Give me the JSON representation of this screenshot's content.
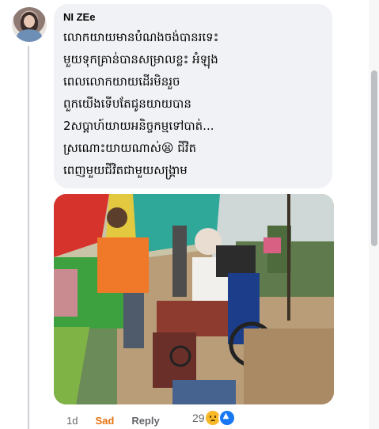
{
  "comment": {
    "author": "NI ZEe",
    "text": "លោកយាយមានបំណងចង់បានរទេះ\nមួយទុកគ្រាន់បានសម្រាលខ្លះ អំឡុង\nពេលលោកយាយដើរមិនរួច\nពួកយើងទើបតែជូនយាយបាន\n2សប្តាហ៍យាយអនិច្ចកម្មទៅបាត់...\nស្រណោះយាយណាស់😫 ជីវិត\nពេញមួយជីវិតជាមួយសង្គ្រាម"
  },
  "actions": {
    "time": "1d",
    "reaction_label": "Sad",
    "reply_label": "Reply",
    "reaction_count": "29"
  },
  "icons": [
    "sad-reaction-icon",
    "like-reaction-icon"
  ],
  "colors": {
    "sad": "#e9710f",
    "like": "#1877f2",
    "bubble": "#f0f2f5"
  }
}
